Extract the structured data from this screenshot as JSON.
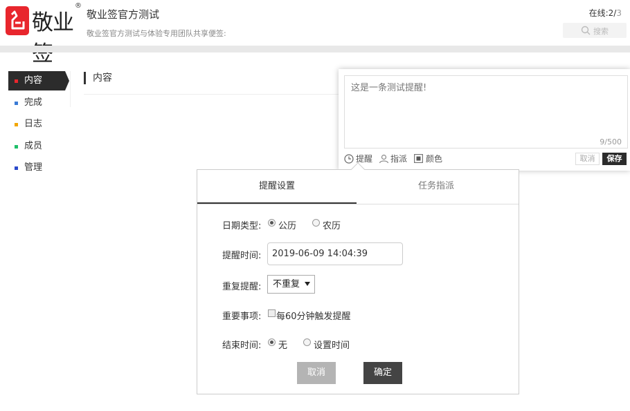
{
  "header": {
    "logo_text": "敬业签",
    "logo_reg": "®",
    "title": "敬业签官方测试",
    "subtitle": "敬业签官方测试与体验专用团队共享便签:",
    "online_label": "在线:",
    "online_count": "2/",
    "online_total": "3",
    "search_placeholder": "搜索"
  },
  "sidebar": {
    "items": [
      {
        "label": "内容",
        "color": "#e8262d",
        "active": true
      },
      {
        "label": "完成",
        "color": "#3a7bd5"
      },
      {
        "label": "日志",
        "color": "#f2a600"
      },
      {
        "label": "成员",
        "color": "#1fbf6a"
      },
      {
        "label": "管理",
        "color": "#2b4acb"
      }
    ]
  },
  "main": {
    "section_title": "内容"
  },
  "note": {
    "text": "这是一条测试提醒!",
    "count": "9/500",
    "tools": {
      "remind": "提醒",
      "assign": "指派",
      "color": "颜色"
    },
    "cancel_label": "取消",
    "save_label": "保存"
  },
  "dialog": {
    "tabs": [
      "提醒设置",
      "任务指派"
    ],
    "date_type": {
      "label": "日期类型:",
      "options": [
        "公历",
        "农历"
      ],
      "selected": "公历"
    },
    "remind_time": {
      "label": "提醒时间:",
      "value": "2019-06-09 14:04:39"
    },
    "repeat": {
      "label": "重复提醒:",
      "value": "不重复"
    },
    "important": {
      "label": "重要事项:",
      "option": "每60分钟触发提醒",
      "checked": false
    },
    "end_time": {
      "label": "结束时间:",
      "options": [
        "无",
        "设置时间"
      ],
      "selected": "无"
    },
    "cancel_label": "取消",
    "ok_label": "确定"
  }
}
